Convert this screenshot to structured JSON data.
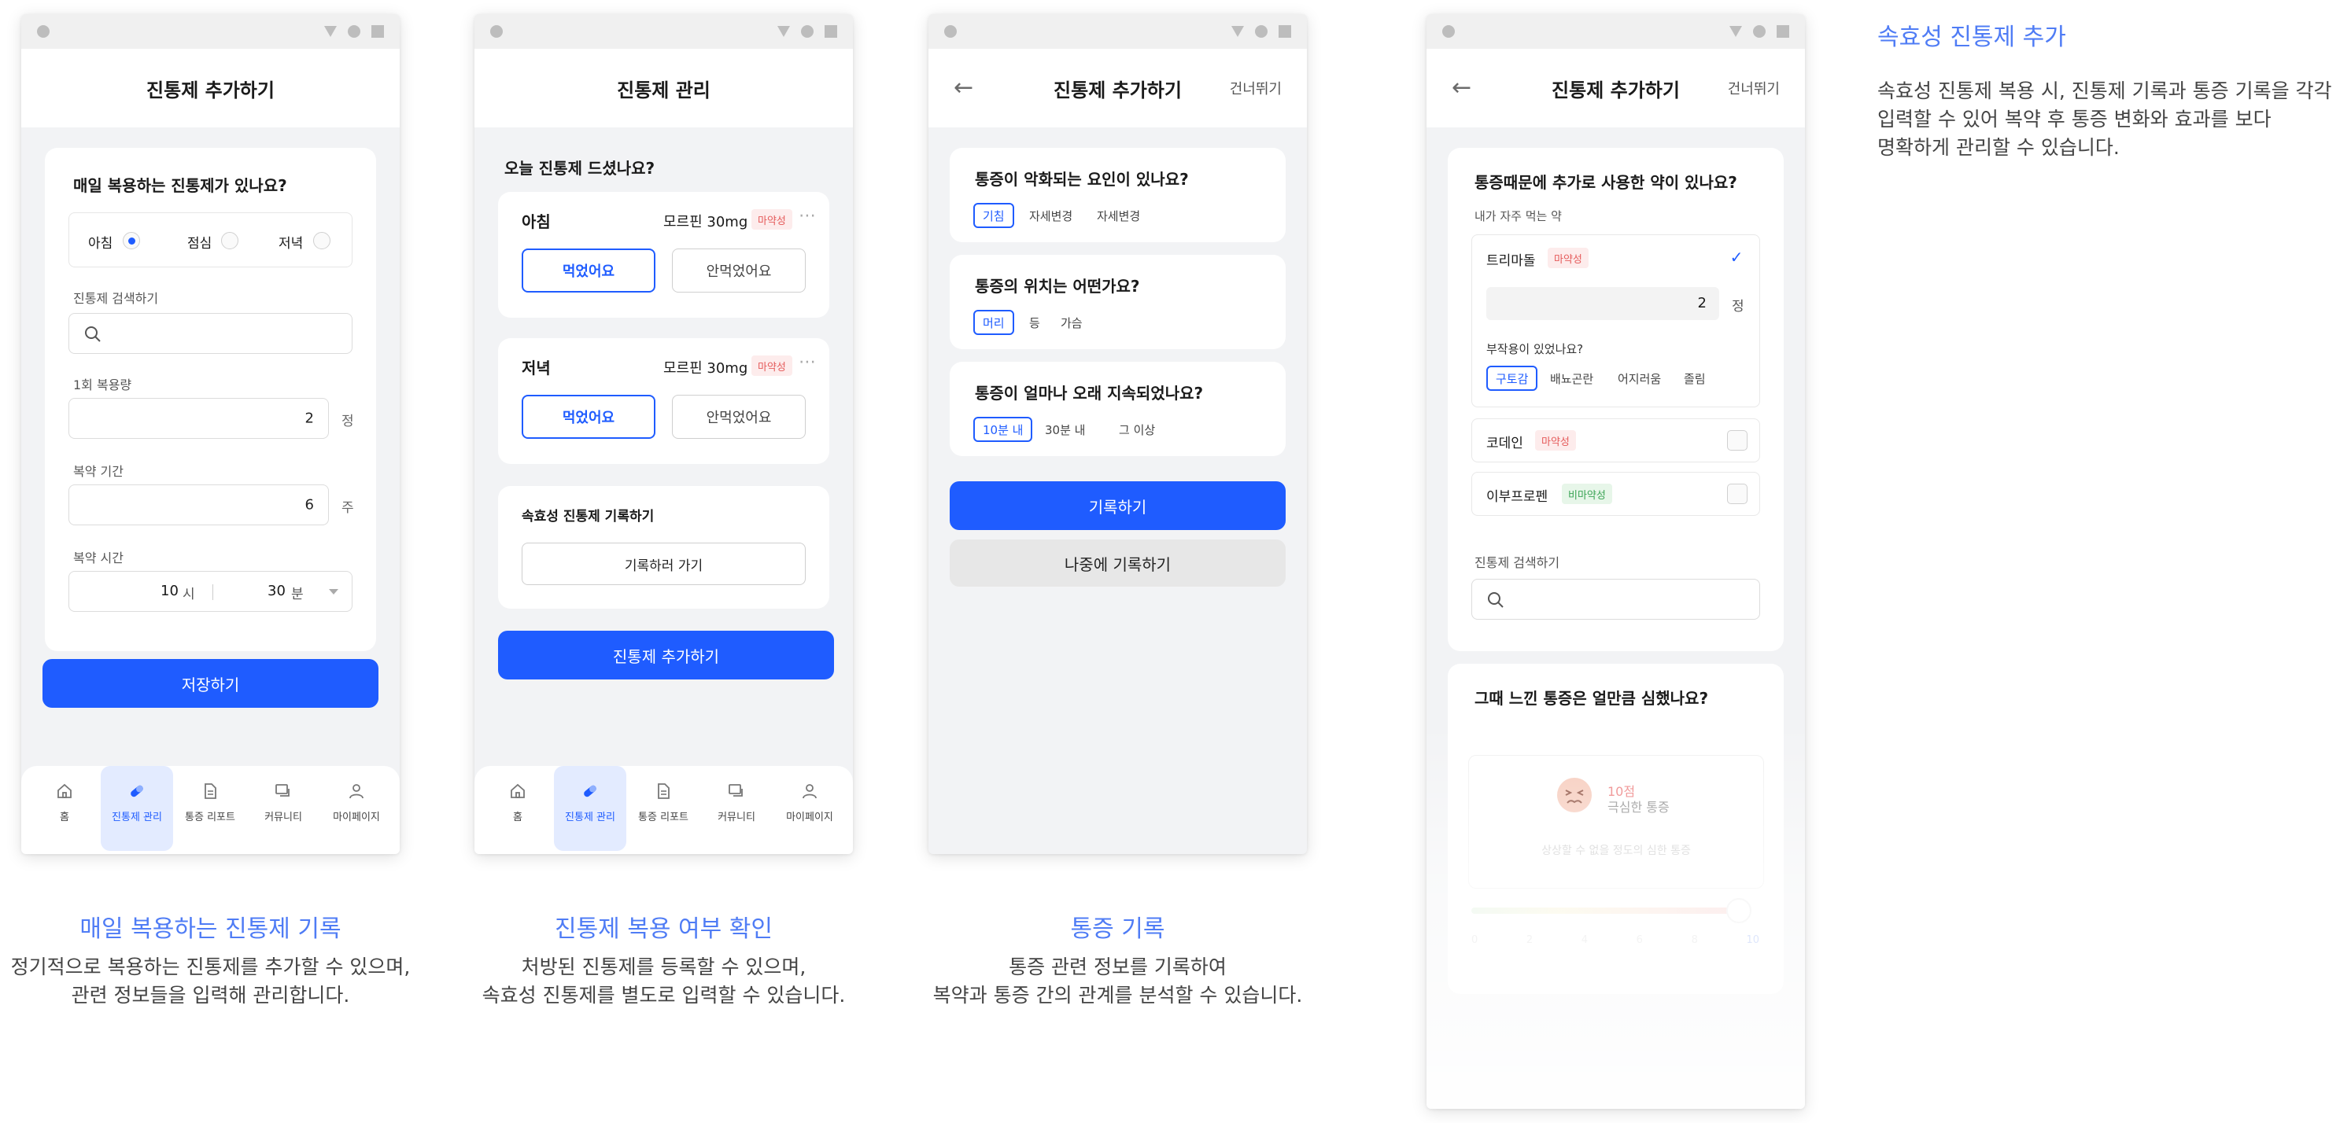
{
  "screen1": {
    "title": "진통제 추가하기",
    "question": "매일 복용하는 진통제가 있나요?",
    "time_options": [
      "아침",
      "점심",
      "저녁"
    ],
    "search_label": "진통제 검색하기",
    "dose_label": "1회 복용량",
    "dose_value": "2",
    "dose_unit": "정",
    "period_label": "복약 기간",
    "period_value": "6",
    "period_unit": "주",
    "time_label": "복약 시간",
    "hour_value": "10",
    "hour_unit": "시",
    "minute_value": "30",
    "minute_unit": "분",
    "save_button": "저장하기"
  },
  "screen2": {
    "title": "진통제 관리",
    "question": "오늘 진통제 드셨나요?",
    "morning": {
      "label": "아침",
      "drug": "모르핀 30mg",
      "tag": "마약성",
      "taken": "먹었어요",
      "not_taken": "안먹었어요"
    },
    "evening": {
      "label": "저녁",
      "drug": "모르핀 30mg",
      "tag": "마약성",
      "taken": "먹었어요",
      "not_taken": "안먹었어요"
    },
    "fast_label": "속효성 진통제 기록하기",
    "fast_button": "기록하러 가기",
    "add_button": "진통제 추가하기"
  },
  "tabbar": {
    "tabs": [
      "홈",
      "진통제 관리",
      "통증 리포트",
      "커뮤니티",
      "마이페이지"
    ]
  },
  "screen3": {
    "title": "진통제 추가하기",
    "skip": "건너뛰기",
    "q1": "통증이 악화되는 요인이 있나요?",
    "q1_chips": [
      "기침",
      "자세변경",
      "자세변경"
    ],
    "q2": "통증의 위치는 어떤가요?",
    "q2_chips": [
      "머리",
      "등",
      "가슴"
    ],
    "q3": "통증이 얼마나 오래 지속되었나요?",
    "q3_chips": [
      "10분 내",
      "30분 내",
      "그 이상"
    ],
    "record_button": "기록하기",
    "later_button": "나중에 기록하기"
  },
  "screen4": {
    "title": "진통제 추가하기",
    "skip": "건너뛰기",
    "question": "통증때문에 추가로 사용한 약이 있나요?",
    "frequent_label": "내가 자주 먹는 약",
    "drug1": {
      "name": "트리마돌",
      "tag": "마약성"
    },
    "drug1_qty": "2",
    "drug1_unit": "정",
    "side_effect_q": "부작용이 있었나요?",
    "side_effects": [
      "구토감",
      "배뇨곤란",
      "어지러움",
      "졸림"
    ],
    "drug2": {
      "name": "코데인",
      "tag": "마약성"
    },
    "drug3": {
      "name": "이부프로펜",
      "tag": "비마약성"
    },
    "search_label": "진통제 검색하기",
    "pain_question": "그때 느낀 통증은 얼만큼 심했나요?",
    "pain_score": "10점",
    "pain_name": "극심한 통증",
    "pain_desc": "상상할 수 없을 정도의 심한 통증",
    "scale_ticks": [
      "0",
      "2",
      "4",
      "6",
      "8",
      "10"
    ],
    "pain_level": 10
  },
  "captions": {
    "c1_title": "매일 복용하는 진통제 기록",
    "c1_desc": "정기적으로 복용하는 진통제를 추가할 수 있으며,\n관련 정보들을 입력해 관리합니다.",
    "c2_title": "진통제 복용 여부 확인",
    "c2_desc": "처방된 진통제를 등록할 수 있으며,\n속효성 진통제를 별도로 입력할 수 있습니다.",
    "c3_title": "통증 기록",
    "c3_desc": "통증 관련 정보를 기록하여\n복약과 통증 간의 관계를 분석할 수 있습니다.",
    "c4_title": "속효성 진통제 추가",
    "c4_desc": "속효성 진통제 복용 시, 진통제 기록과 통증 기록을 각각\n입력할 수 있어 복약 후 통증 변화와 효과를 보다\n명확하게 관리할 수 있습니다."
  },
  "colors": {
    "primary": "#1f5cff",
    "caption": "#4f7cf5",
    "danger_tag": "#e55a5a",
    "safe_tag": "#3aa455"
  }
}
